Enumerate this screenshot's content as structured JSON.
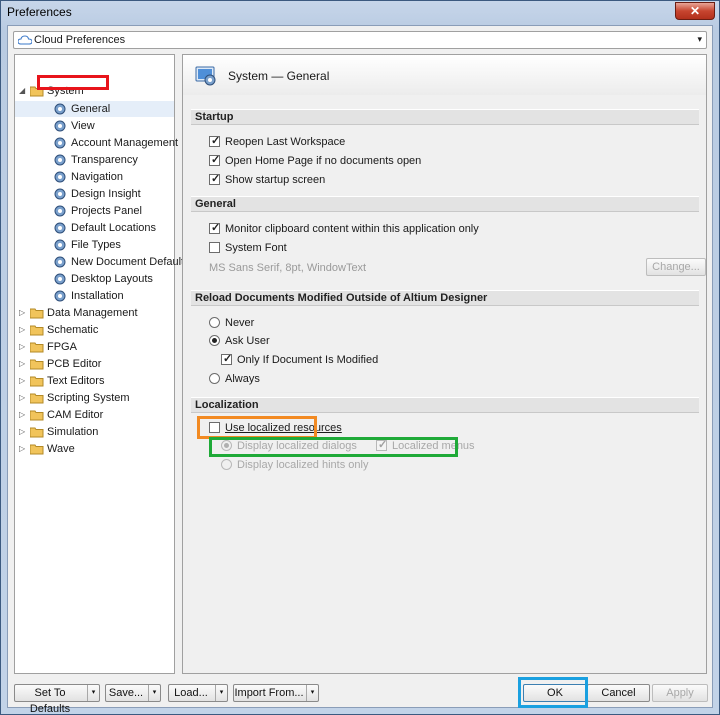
{
  "window": {
    "title": "Preferences",
    "close_glyph": "✕"
  },
  "combo": {
    "value": "Cloud Preferences",
    "arrow": "▾"
  },
  "tree": {
    "system": {
      "label": "System",
      "expander": "◢"
    },
    "children": [
      "General",
      "View",
      "Account Management",
      "Transparency",
      "Navigation",
      "Design Insight",
      "Projects Panel",
      "Default Locations",
      "File Types",
      "New Document Defaults",
      "Desktop Layouts",
      "Installation"
    ],
    "groups": [
      "Data Management",
      "Schematic",
      "FPGA",
      "PCB Editor",
      "Text Editors",
      "Scripting System",
      "CAM Editor",
      "Simulation",
      "Wave"
    ],
    "collapsed_glyph": "▷"
  },
  "page": {
    "title": "System — General",
    "sections": {
      "startup": "Startup",
      "general": "General",
      "reload": "Reload Documents Modified Outside of Altium Designer",
      "localization": "Localization"
    },
    "startup": {
      "reopen": "Reopen Last Workspace",
      "home": "Open Home Page if no documents open",
      "splash": "Show startup screen"
    },
    "general": {
      "clipboard": "Monitor clipboard content within this application only",
      "system_font": "System Font",
      "font_desc": "MS Sans Serif, 8pt, WindowText",
      "change": "Change..."
    },
    "reload": {
      "never": "Never",
      "ask": "Ask User",
      "only_modified": "Only If Document Is Modified",
      "always": "Always"
    },
    "localization": {
      "use": "Use localized resources",
      "dialogs": "Display localized dialogs",
      "menus": "Localized menus",
      "hints": "Display localized hints only"
    }
  },
  "buttons": {
    "defaults": "Set To Defaults",
    "save": "Save...",
    "load": "Load...",
    "import": "Import From...",
    "ok": "OK",
    "cancel": "Cancel",
    "apply": "Apply",
    "dd": "▾"
  },
  "colors": {
    "red_box": "#e8141b",
    "orange_box": "#f28a22",
    "green_box": "#1faa38",
    "blue_box": "#1aa0e0"
  }
}
